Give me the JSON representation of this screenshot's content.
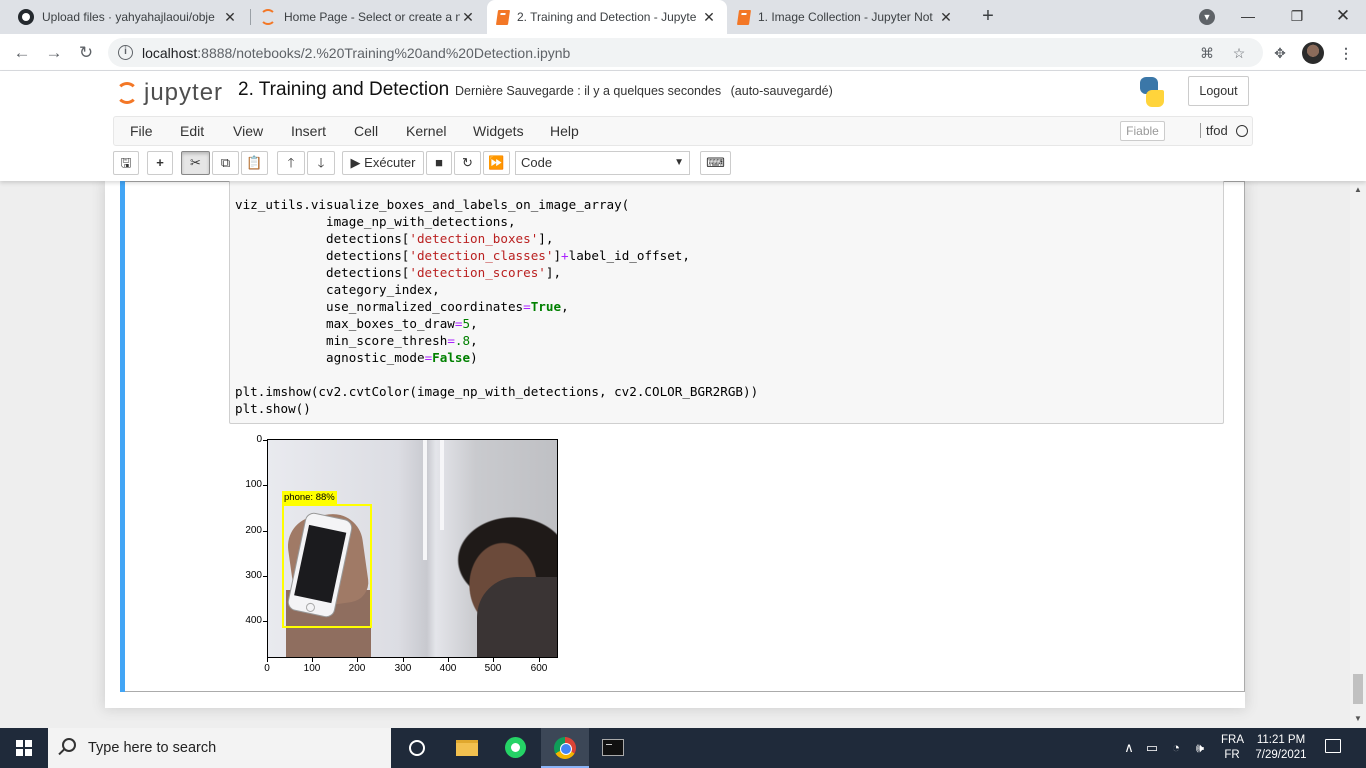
{
  "browser": {
    "tabs": [
      {
        "title": "Upload files · yahyahajlaoui/obje",
        "icon": "github-icon",
        "active": false
      },
      {
        "title": "Home Page - Select or create a n",
        "icon": "jupyter-ring-icon",
        "active": false
      },
      {
        "title": "2. Training and Detection - Jupyte",
        "icon": "jupyter-notebook-icon",
        "active": true
      },
      {
        "title": "1. Image Collection - Jupyter Not",
        "icon": "jupyter-notebook-icon",
        "active": false
      }
    ],
    "url_host": "localhost",
    "url_rest": ":8888/notebooks/2.%20Training%20and%20Detection.ipynb"
  },
  "jupyter": {
    "logo_text": "jupyter",
    "notebook_title": "2. Training and Detection",
    "save_status": "Dernière Sauvegarde : il y a quelques secondes",
    "autosave": "(auto-sauvegardé)",
    "logout_label": "Logout",
    "menu": [
      "File",
      "Edit",
      "View",
      "Insert",
      "Cell",
      "Kernel",
      "Widgets",
      "Help"
    ],
    "trusted_label": "Fiable",
    "kernel_name": "tfod",
    "run_label": "Exécuter",
    "cell_type": "Code"
  },
  "cell": {
    "code_lines": [
      "viz_utils.visualize_boxes_and_labels_on_image_array(",
      "            image_np_with_detections,",
      "            detections['detection_boxes'],",
      "            detections['detection_classes']+label_id_offset,",
      "            detections['detection_scores'],",
      "            category_index,",
      "            use_normalized_coordinates=True,",
      "            max_boxes_to_draw=5,",
      "            min_score_thresh=.8,",
      "            agnostic_mode=False)",
      "",
      "plt.imshow(cv2.cvtColor(image_np_with_detections, cv2.COLOR_BGR2RGB))",
      "plt.show()"
    ]
  },
  "output": {
    "detection_label": "phone: 88%",
    "y_ticks": [
      "0",
      "100",
      "200",
      "300",
      "400"
    ],
    "x_ticks": [
      "0",
      "100",
      "200",
      "300",
      "400",
      "500",
      "600"
    ]
  },
  "taskbar": {
    "search_placeholder": "Type here to search",
    "lang_top": "FRA",
    "lang_bottom": "FR",
    "time": "11:21 PM",
    "date": "7/29/2021"
  },
  "colors": {
    "accent_cell": "#42a5f5",
    "jupyter_orange": "#f37726",
    "detection_box": "#ffff00"
  }
}
